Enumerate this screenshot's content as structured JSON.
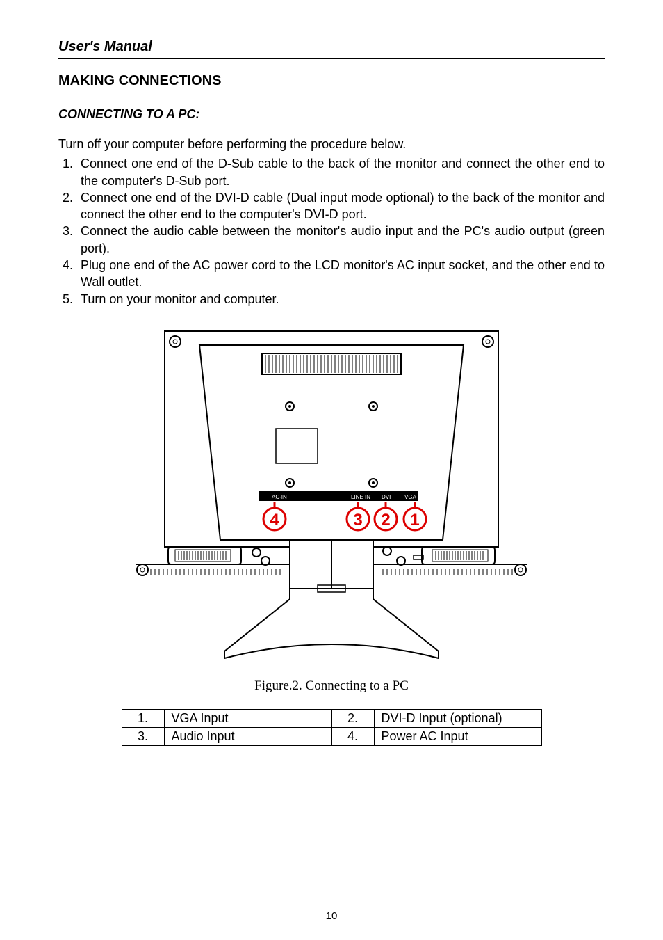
{
  "header": {
    "title": "User's Manual"
  },
  "section": {
    "heading": "MAKING CONNECTIONS",
    "sub_heading": "CONNECTING TO A PC:",
    "intro": "Turn off your computer before performing the procedure below.",
    "steps": [
      "Connect one end of the D-Sub cable to the back of the monitor and connect the other end to the computer's D-Sub port.",
      "Connect one end of the DVI-D cable (Dual input mode optional) to the back of the monitor and connect the other end to the computer's DVI-D port.",
      "Connect the audio cable between the monitor's audio input and the PC's audio output (green port).",
      "Plug one end of the AC power cord to the LCD monitor's AC input socket, and the other end to Wall outlet.",
      "Turn on your monitor and computer."
    ]
  },
  "figure": {
    "caption": "Figure.2. Connecting to a PC",
    "labels": {
      "ac_in": "AC-IN",
      "line_in": "LINE IN",
      "dvi": "DVI",
      "vga": "VGA"
    },
    "callouts": {
      "1": "1",
      "2": "2",
      "3": "3",
      "4": "4"
    }
  },
  "table": {
    "rows": [
      {
        "n1": "1.",
        "l1": "VGA Input",
        "n2": "2.",
        "l2": "DVI-D Input (optional)"
      },
      {
        "n1": "3.",
        "l1": "Audio Input",
        "n2": "4.",
        "l2": "Power AC Input"
      }
    ]
  },
  "page_number": "10"
}
